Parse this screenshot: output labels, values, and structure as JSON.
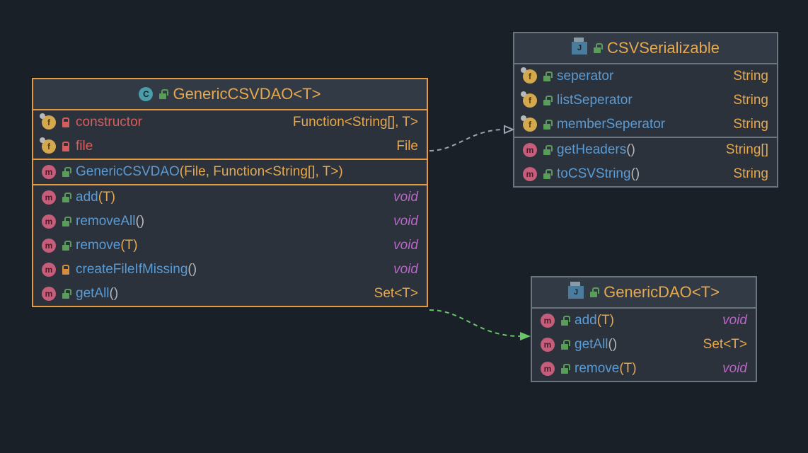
{
  "classes": {
    "genericCSVDAO": {
      "title": "GenericCSVDAO<T>",
      "fields": [
        {
          "name": "constructor",
          "type": "Function<String[], T>"
        },
        {
          "name": "file",
          "type": "File"
        }
      ],
      "constructor": {
        "signature": "GenericCSVDAO",
        "params": "(File, Function<String[], T>)"
      },
      "methods": [
        {
          "name": "add",
          "params": "(T)",
          "ret": "void",
          "access": "public"
        },
        {
          "name": "removeAll",
          "params": "()",
          "ret": "void",
          "access": "public"
        },
        {
          "name": "remove",
          "params": "(T)",
          "ret": "void",
          "access": "public"
        },
        {
          "name": "createFileIfMissing",
          "params": "()",
          "ret": "void",
          "access": "protected"
        },
        {
          "name": "getAll",
          "params": "()",
          "ret": "Set<T>",
          "access": "public"
        }
      ]
    },
    "csvSerializable": {
      "title": "CSVSerializable",
      "fields": [
        {
          "name": "seperator",
          "type": "String"
        },
        {
          "name": "listSeperator",
          "type": "String"
        },
        {
          "name": "memberSeperator",
          "type": "String"
        }
      ],
      "methods": [
        {
          "name": "getHeaders",
          "params": "()",
          "ret": "String[]"
        },
        {
          "name": "toCSVString",
          "params": "()",
          "ret": "String"
        }
      ]
    },
    "genericDAO": {
      "title": "GenericDAO<T>",
      "methods": [
        {
          "name": "add",
          "params": "(T)",
          "ret": "void"
        },
        {
          "name": "getAll",
          "params": "()",
          "ret": "Set<T>"
        },
        {
          "name": "remove",
          "params": "(T)",
          "ret": "void"
        }
      ]
    }
  }
}
